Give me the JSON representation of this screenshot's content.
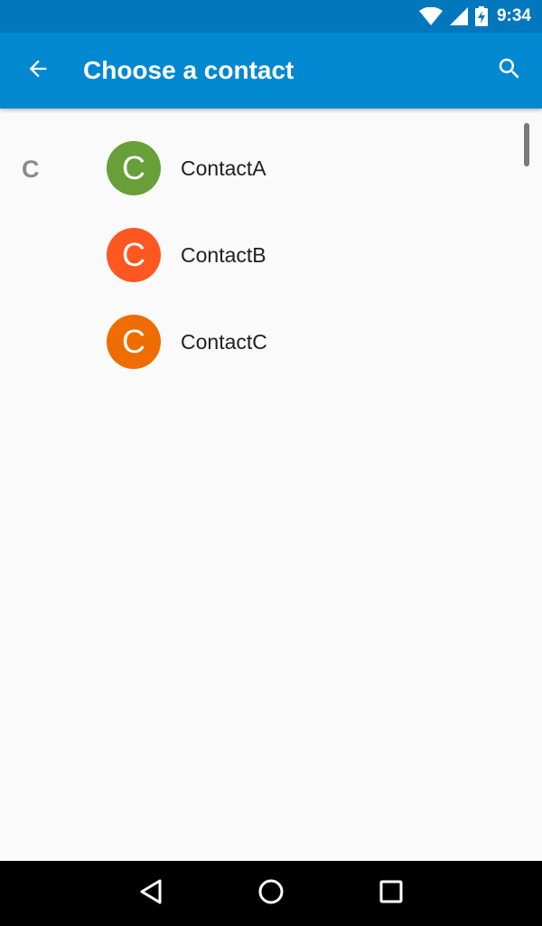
{
  "status_bar": {
    "time": "9:34",
    "icons": [
      "wifi-icon",
      "cell-signal-icon",
      "battery-charging-icon"
    ],
    "color": "#0277bd"
  },
  "app_bar": {
    "title": "Choose a contact",
    "back_icon": "arrow-back-icon",
    "search_icon": "search-icon",
    "color": "#0288d1"
  },
  "contacts": {
    "section_letter": "C",
    "items": [
      {
        "initial": "C",
        "name": "ContactA",
        "avatar_color": "#689f38"
      },
      {
        "initial": "C",
        "name": "ContactB",
        "avatar_color": "#ff5722"
      },
      {
        "initial": "C",
        "name": "ContactC",
        "avatar_color": "#ef6c00"
      }
    ]
  },
  "nav_bar": {
    "buttons": [
      "back-triangle-icon",
      "home-circle-icon",
      "recents-square-icon"
    ]
  }
}
